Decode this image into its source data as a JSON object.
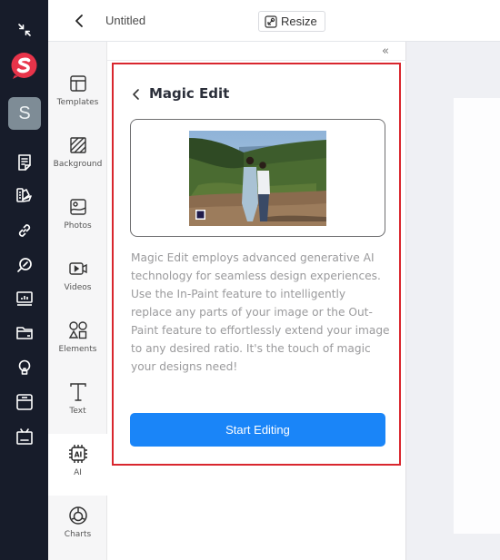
{
  "app": {
    "document_title": "Untitled",
    "resize_label": "Resize",
    "collapse_glyph": "«"
  },
  "rail": {
    "avatar_letter": "S",
    "brand_color": "#e8344a",
    "items": [
      {
        "name": "collapse-arrows",
        "icon": "minimize-arrows-icon"
      },
      {
        "name": "my-designs",
        "icon": "document-edit-icon"
      },
      {
        "name": "brand-kit",
        "icon": "palette-icon"
      },
      {
        "name": "links",
        "icon": "link-icon"
      },
      {
        "name": "search",
        "icon": "search-icon"
      },
      {
        "name": "analytics",
        "icon": "monitor-chart-icon"
      },
      {
        "name": "folders",
        "icon": "folder-icon"
      },
      {
        "name": "ideas",
        "icon": "lightbulb-icon"
      },
      {
        "name": "archive",
        "icon": "archive-box-icon"
      },
      {
        "name": "calendar",
        "icon": "calendar-icon"
      }
    ]
  },
  "tabs": [
    {
      "label": "Templates",
      "icon": "layout-icon",
      "active": false
    },
    {
      "label": "Background",
      "icon": "hatched-square-icon",
      "active": false
    },
    {
      "label": "Photos",
      "icon": "image-icon",
      "active": false
    },
    {
      "label": "Videos",
      "icon": "video-camera-icon",
      "active": false
    },
    {
      "label": "Elements",
      "icon": "shapes-icon",
      "active": false
    },
    {
      "label": "Text",
      "icon": "text-t-icon",
      "active": false
    },
    {
      "label": "AI",
      "icon": "ai-chip-icon",
      "active": true
    },
    {
      "label": "Charts",
      "icon": "donut-chart-icon",
      "active": false
    }
  ],
  "magic_edit": {
    "title": "Magic Edit",
    "description": "Magic Edit employs advanced generative AI technology for seamless design experiences. Use the In-Paint feature to intelligently replace any parts of your image or the Out-Paint feature to effortlessly extend your image to any desired ratio. It's the touch of magic your designs need!",
    "button_label": "Start Editing",
    "button_color": "#1a85f8",
    "highlight_color": "#d9262e"
  }
}
